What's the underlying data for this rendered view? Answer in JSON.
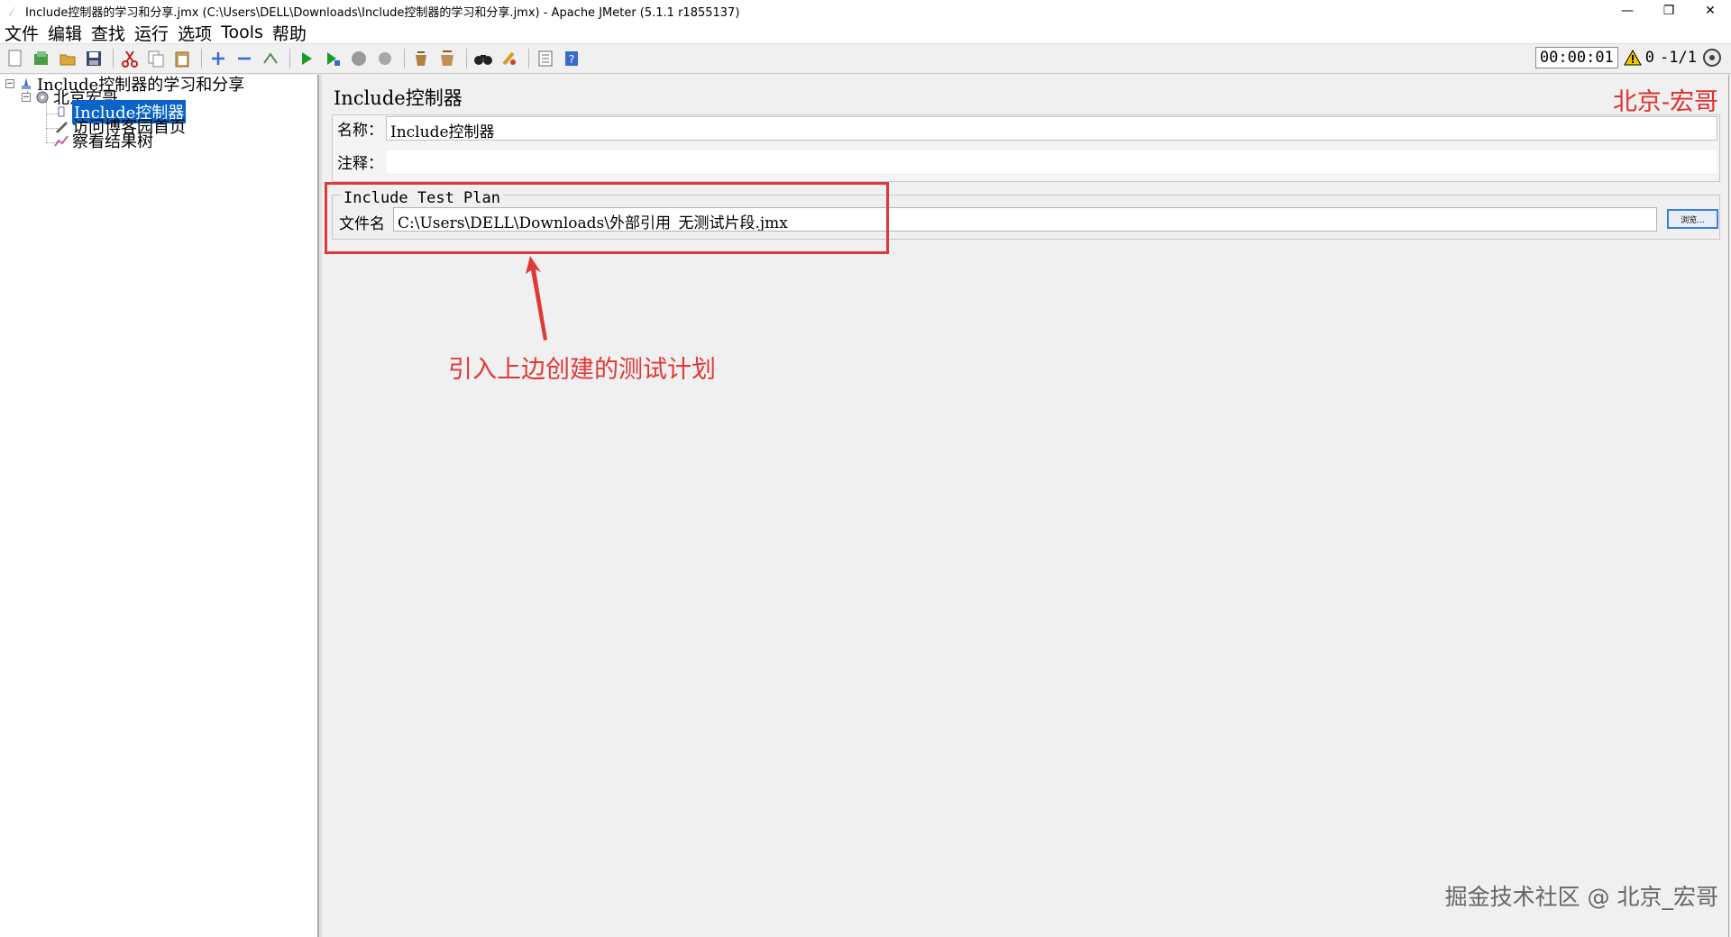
{
  "window": {
    "title": "Include控制器的学习和分享.jmx (C:\\Users\\DELL\\Downloads\\Include控制器的学习和分享.jmx) - Apache JMeter (5.1.1 r1855137)",
    "minimize": "—",
    "restore": "❐",
    "close": "✕"
  },
  "menu": [
    "文件",
    "编辑",
    "查找",
    "运行",
    "选项",
    "Tools",
    "帮助"
  ],
  "toolbar": {
    "timer": "00:00:01",
    "warn_count": "0",
    "threads": "-1/1"
  },
  "tree": {
    "root": "Include控制器的学习和分享",
    "thread_group": "北京宏哥",
    "include_controller": "Include控制器",
    "sampler": "访问博客园首页",
    "listener": "察看结果树"
  },
  "panel": {
    "title": "Include控制器",
    "watermark_top": "北京-宏哥",
    "name_label": "名称：",
    "name_value": "Include控制器",
    "comment_label": "注释：",
    "comment_value": "",
    "group_title": "Include Test Plan",
    "file_label": "文件名",
    "file_value": "C:\\Users\\DELL\\Downloads\\外部引用_无测试片段.jmx",
    "browse_label": "浏览...",
    "annotation": "引入上边创建的测试计划",
    "watermark_bottom": "掘金技术社区 @ 北京_宏哥"
  },
  "colors": {
    "accent_red": "#e03838",
    "selection_blue": "#0a64c8"
  }
}
